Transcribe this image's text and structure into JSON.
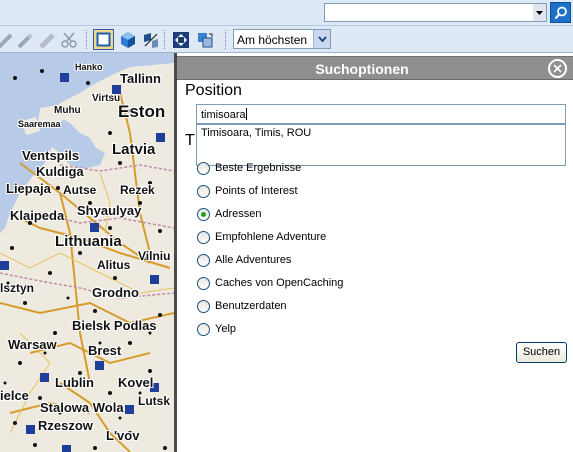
{
  "top_bar": {
    "search_value": "",
    "icons": [
      "dropdown-arrow-icon",
      "magnifier-icon"
    ]
  },
  "toolbar": {
    "icons": [
      "pencil-icon",
      "route-pencil-icon",
      "eraser-icon",
      "scissors-icon",
      "map-view-icon",
      "3d-cube-icon",
      "layers-icon",
      "fullscreen-icon",
      "swap-icon"
    ],
    "altitude_select": "Am höchsten"
  },
  "map": {
    "labels": [
      {
        "text": "Hanko"
      },
      {
        "text": "Tallinn"
      },
      {
        "text": "Virtsu"
      },
      {
        "text": "Muhu"
      },
      {
        "text": "Eston"
      },
      {
        "text": "Saaremaa"
      },
      {
        "text": "Ventspils"
      },
      {
        "text": "Latvia"
      },
      {
        "text": "Kuldiga"
      },
      {
        "text": "Liepaja"
      },
      {
        "text": "Autse"
      },
      {
        "text": "Rezek"
      },
      {
        "text": "Klaipeda"
      },
      {
        "text": "Shyaulyay"
      },
      {
        "text": "Lithuania"
      },
      {
        "text": "Vilniu"
      },
      {
        "text": "Alitus"
      },
      {
        "text": "Grodno"
      },
      {
        "text": "lsztyn"
      },
      {
        "text": "Bielsk Podlas"
      },
      {
        "text": "Warsaw"
      },
      {
        "text": "Brest"
      },
      {
        "text": "Lublin"
      },
      {
        "text": "Kovel"
      },
      {
        "text": "ielce"
      },
      {
        "text": "Stalowa Wola"
      },
      {
        "text": "Lutsk"
      },
      {
        "text": "Rzeszow"
      },
      {
        "text": "L'vov"
      }
    ]
  },
  "panel": {
    "title": "Suchoptionen",
    "position_label": "Position",
    "position_value": "timisoara",
    "suggestion": "Timisoara, Timis, ROU",
    "type_label": "T",
    "options": [
      {
        "label": "Beste Ergebnisse",
        "checked": false
      },
      {
        "label": "Points of Interest",
        "checked": false
      },
      {
        "label": "Adressen",
        "checked": true
      },
      {
        "label": "Empfohlene Adventure",
        "checked": false
      },
      {
        "label": "Alle Adventures",
        "checked": false
      },
      {
        "label": "Caches von OpenCaching",
        "checked": false
      },
      {
        "label": "Benutzerdaten",
        "checked": false
      },
      {
        "label": "Yelp",
        "checked": false
      }
    ],
    "search_button": "Suchen"
  },
  "colors": {
    "header_bg": "#8f8f8f",
    "toolbar_bg": "#dfe9f5",
    "radio_checked": "#21a121",
    "search_button_blue": "#1d6fc7"
  }
}
